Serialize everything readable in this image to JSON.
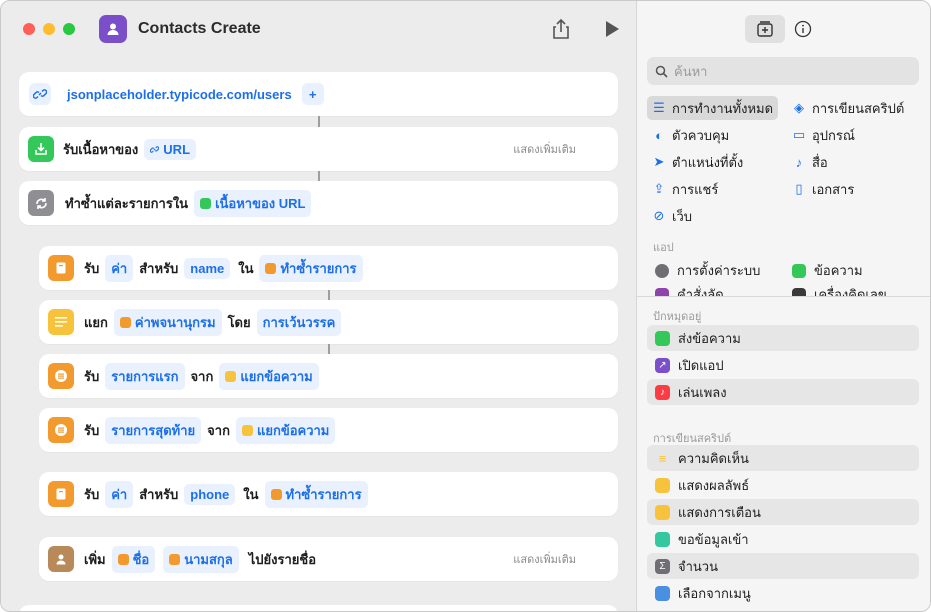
{
  "window": {
    "title": "Contacts Create"
  },
  "editor": {
    "url_action": {
      "url": "jsonplaceholder.typicode.com/users",
      "add_glyph": "+"
    },
    "actions": [
      {
        "id": "get-contents",
        "label": "รับเนื้อหาของ",
        "token": "URL",
        "more": "แสดงเพิ่มเติม",
        "icon": "download-icon",
        "color": "#34c759"
      },
      {
        "id": "repeat-each",
        "label": "ทำซ้ำแต่ละรายการใน",
        "token": "เนื้อหาของ URL",
        "icon": "repeat-icon",
        "color": "#8e8e93"
      },
      {
        "id": "get-value-name",
        "w1": "รับ",
        "t1": "ค่า",
        "w2": "สำหรับ",
        "t2": "name",
        "w3": "ใน",
        "t3": "ทำซ้ำรายการ",
        "icon": "dictionary-icon",
        "color": "#f39a2e"
      },
      {
        "id": "split-text",
        "w1": "แยก",
        "t1": "ค่าพจนานุกรม",
        "w2": "โดย",
        "t2": "การเว้นวรรค",
        "icon": "text-icon",
        "color": "#f7c33c"
      },
      {
        "id": "get-first",
        "w1": "รับ",
        "t1": "รายการแรก",
        "w2": "จาก",
        "t2": "แยกข้อความ",
        "icon": "list-icon",
        "color": "#f39a2e"
      },
      {
        "id": "get-last",
        "w1": "รับ",
        "t1": "รายการสุดท้าย",
        "w2": "จาก",
        "t2": "แยกข้อความ",
        "icon": "list-icon",
        "color": "#f39a2e"
      },
      {
        "id": "get-value-phone",
        "w1": "รับ",
        "t1": "ค่า",
        "w2": "สำหรับ",
        "t2": "phone",
        "w3": "ใน",
        "t3": "ทำซ้ำรายการ",
        "icon": "dictionary-icon",
        "color": "#f39a2e"
      },
      {
        "id": "add-contact",
        "w1": "เพิ่ม",
        "t1": "ชื่อ",
        "t2": "นามสกุล",
        "w2": "ไปยังรายชื่อ",
        "more": "แสดงเพิ่มเติม",
        "icon": "contacts-icon",
        "color": "#b88a5a"
      }
    ]
  },
  "sidebar": {
    "search_placeholder": "ค้นหา",
    "categories": [
      {
        "label": "การทำงานทั้งหมด",
        "glyph": "☰",
        "selected": true
      },
      {
        "label": "การเขียนสคริปต์",
        "glyph": "◈"
      },
      {
        "label": "ตัวควบคุม",
        "glyph": "◐"
      },
      {
        "label": "อุปกรณ์",
        "glyph": "▭"
      },
      {
        "label": "ตำแหน่งที่ตั้ง",
        "glyph": "➤"
      },
      {
        "label": "สื่อ",
        "glyph": "♪"
      },
      {
        "label": "การแชร์",
        "glyph": "⇪"
      },
      {
        "label": "เอกสาร",
        "glyph": "▯"
      },
      {
        "label": "เว็บ",
        "glyph": "⊘"
      }
    ],
    "apps_label": "แอป",
    "apps": [
      {
        "label": "การตั้งค่าระบบ",
        "color": "#6e6e73"
      },
      {
        "label": "ข้อความ",
        "color": "#34c759"
      },
      {
        "label": "คำสั่งลัด",
        "color": "#8e44ad"
      },
      {
        "label": "เครื่องคิดเลข",
        "color": "#3a3a3c"
      }
    ],
    "pinned_label": "ปักหมุดอยู่",
    "pinned": [
      {
        "label": "ส่งข้อความ",
        "color": "#34c759"
      },
      {
        "label": "เปิดแอป",
        "color": "#7b4fc9"
      },
      {
        "label": "เล่นเพลง",
        "color": "#fc3c44"
      }
    ],
    "scripting_label": "การเขียนสคริปต์",
    "scripting": [
      {
        "label": "ความคิดเห็น",
        "color": "#f7c33c"
      },
      {
        "label": "แสดงผลลัพธ์",
        "color": "#f7c33c"
      },
      {
        "label": "แสดงการเตือน",
        "color": "#f7c33c"
      },
      {
        "label": "ขอข้อมูลเข้า",
        "color": "#34c7a0"
      },
      {
        "label": "จำนวน",
        "color": "#6e6e73"
      },
      {
        "label": "เลือกจากเมนู",
        "color": "#4a90e2"
      }
    ]
  }
}
